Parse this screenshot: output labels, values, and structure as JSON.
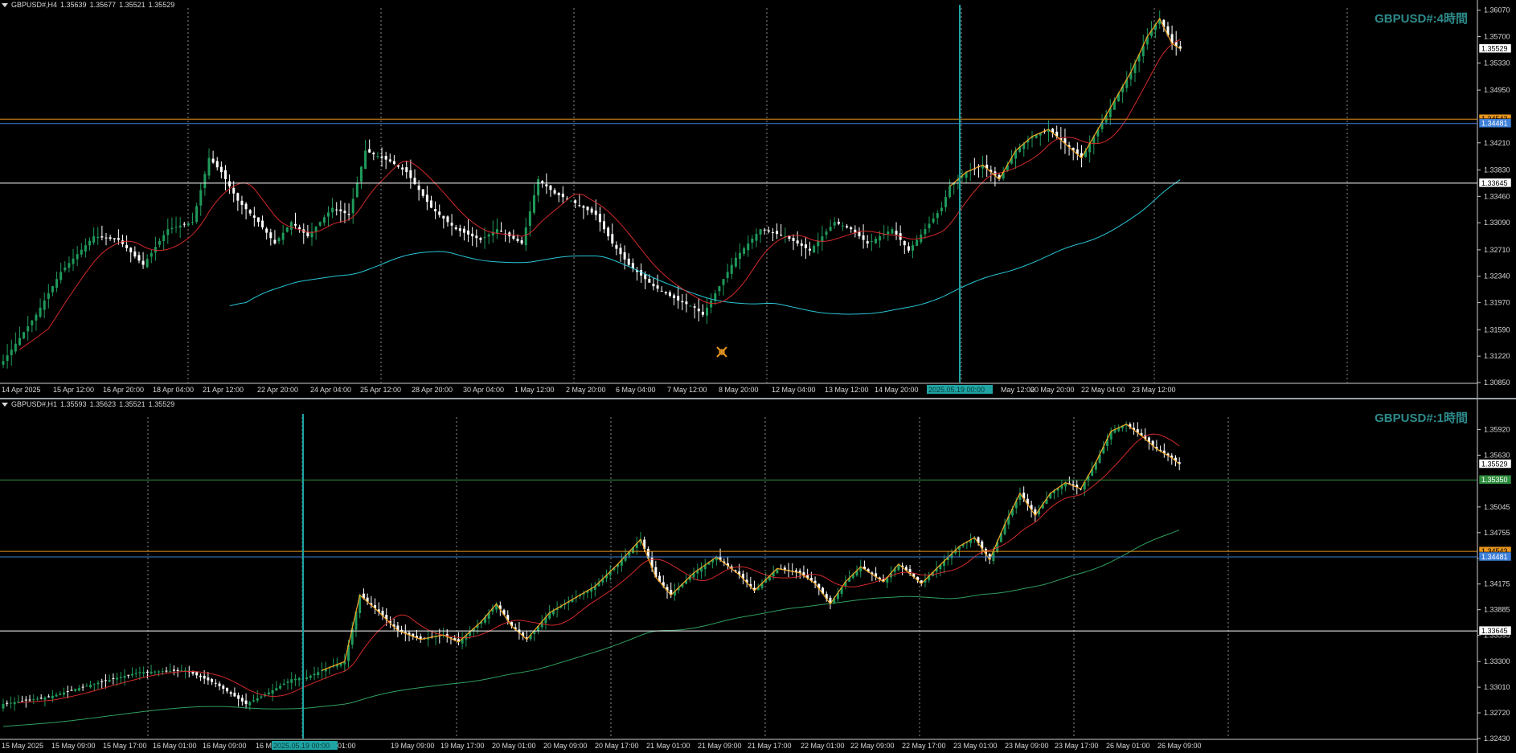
{
  "charts": [
    {
      "symbol": "GBPUSD#,H4",
      "ohlc": [
        "1.35639",
        "1.35677",
        "1.35521",
        "1.35529"
      ],
      "title": "GBPUSD#:4時間",
      "price_axis": [
        "1.36070",
        "1.35700",
        "1.35330",
        "1.34950",
        "1.34210",
        "1.33830",
        "1.33460",
        "1.33090",
        "1.32710",
        "1.32340",
        "1.31970",
        "1.31590",
        "1.31220",
        "1.30850"
      ],
      "time_axis": [
        "14 Apr 2025",
        "15 Apr 12:00",
        "16 Apr 20:00",
        "18 Apr 04:00",
        "21 Apr 12:00",
        "22 Apr 20:00",
        "24 Apr 04:00",
        "25 Apr 12:00",
        "28 Apr 20:00",
        "30 Apr 04:00",
        "1 May 12:00",
        "2 May 20:00",
        "6 May 04:00",
        "7 May 12:00",
        "8 May 20:00",
        "12 May 04:00",
        "13 May 12:00",
        "14 May 20:00",
        "2025.05.19 00:00",
        "May 12:00",
        "20 May 20:00",
        "22 May 04:00",
        "23 May 12:00"
      ],
      "level_tags": [
        "1.35529",
        "1.34543",
        "1.34481",
        "1.33645"
      ],
      "cursor_label": "2025.05.19 00:00"
    },
    {
      "symbol": "GBPUSD#,H1",
      "ohlc": [
        "1.35593",
        "1.35623",
        "1.35521",
        "1.35529"
      ],
      "title": "GBPUSD#:1時間",
      "price_axis": [
        "1.35920",
        "1.35630",
        "1.35045",
        "1.34755",
        "1.34465",
        "1.34175",
        "1.33885",
        "1.33595",
        "1.33300",
        "1.33010",
        "1.32720",
        "1.32430"
      ],
      "time_axis": [
        "15 May 2025",
        "15 May 09:00",
        "15 May 17:00",
        "16 May 01:00",
        "16 May 09:00",
        "16 M",
        "2025.05.19 00:00",
        "01:00",
        "19 May 09:00",
        "19 May 17:00",
        "20 May 01:00",
        "20 May 09:00",
        "20 May 17:00",
        "21 May 01:00",
        "21 May 09:00",
        "21 May 17:00",
        "22 May 01:00",
        "22 May 09:00",
        "22 May 17:00",
        "23 May 01:00",
        "23 May 09:00",
        "23 May 17:00",
        "26 May 01:00",
        "26 May 09:00"
      ],
      "level_tags": [
        "1.35529",
        "1.35350",
        "1.34543",
        "1.34481",
        "1.33645"
      ],
      "cursor_label": "2025.05.19 00:00"
    }
  ],
  "colors": {
    "bull": "#1f9a5a",
    "bear": "#ffffff",
    "ma_fast": "#d42a2a",
    "ma_slow_h4": "#29c6d6",
    "ma_slow_h1": "#2f9f5f",
    "zigzag": "#f5a623",
    "grid": "#c8c8c8",
    "cursor": "#1fa3a3",
    "level_orange": "#e8961e",
    "level_blue": "#3e7fd8",
    "level_white": "#ffffff",
    "level_green": "#2f8f3f",
    "title": "#2e8b8b"
  },
  "chart_data": [
    {
      "type": "candlestick",
      "timeframe": "H4",
      "title": "GBPUSD#:4時間",
      "ylim": [
        1.3085,
        1.361
      ],
      "anchors": [
        [
          0,
          1.3115
        ],
        [
          8,
          1.318
        ],
        [
          14,
          1.324
        ],
        [
          22,
          1.329
        ],
        [
          28,
          1.3285
        ],
        [
          34,
          1.325
        ],
        [
          40,
          1.33
        ],
        [
          46,
          1.331
        ],
        [
          50,
          1.34
        ],
        [
          53,
          1.338
        ],
        [
          57,
          1.334
        ],
        [
          62,
          1.331
        ],
        [
          66,
          1.328
        ],
        [
          70,
          1.331
        ],
        [
          74,
          1.329
        ],
        [
          80,
          1.333
        ],
        [
          84,
          1.332
        ],
        [
          88,
          1.341
        ],
        [
          94,
          1.3395
        ],
        [
          98,
          1.338
        ],
        [
          104,
          1.333
        ],
        [
          110,
          1.33
        ],
        [
          116,
          1.3285
        ],
        [
          120,
          1.33
        ],
        [
          126,
          1.328
        ],
        [
          130,
          1.337
        ],
        [
          134,
          1.335
        ],
        [
          138,
          1.334
        ],
        [
          144,
          1.332
        ],
        [
          148,
          1.328
        ],
        [
          152,
          1.325
        ],
        [
          158,
          1.322
        ],
        [
          164,
          1.32
        ],
        [
          168,
          1.319
        ],
        [
          170,
          1.318
        ],
        [
          174,
          1.322
        ],
        [
          178,
          1.326
        ],
        [
          184,
          1.33
        ],
        [
          190,
          1.329
        ],
        [
          196,
          1.327
        ],
        [
          202,
          1.331
        ],
        [
          206,
          1.33
        ],
        [
          210,
          1.328
        ],
        [
          216,
          1.33
        ],
        [
          220,
          1.327
        ],
        [
          224,
          1.33
        ],
        [
          228,
          1.333
        ],
        [
          230,
          1.336
        ],
        [
          234,
          1.338
        ],
        [
          238,
          1.339
        ],
        [
          242,
          1.337
        ],
        [
          246,
          1.341
        ],
        [
          250,
          1.343
        ],
        [
          254,
          1.344
        ],
        [
          258,
          1.342
        ],
        [
          262,
          1.34
        ],
        [
          266,
          1.344
        ],
        [
          270,
          1.348
        ],
        [
          274,
          1.352
        ],
        [
          278,
          1.357
        ],
        [
          281,
          1.3595
        ],
        [
          284,
          1.356
        ],
        [
          286,
          1.3553
        ]
      ],
      "candle_count": 287,
      "levels": {
        "orange": 1.34543,
        "blue": 1.34481,
        "white": 1.33645,
        "last": 1.35529
      },
      "series": [
        {
          "name": "zigzag"
        },
        {
          "name": "MA fast"
        },
        {
          "name": "MA slow"
        }
      ]
    },
    {
      "type": "candlestick",
      "timeframe": "H1",
      "title": "GBPUSD#:1時間",
      "ylim": [
        1.3243,
        1.3606
      ],
      "anchors": [
        [
          0,
          1.3282
        ],
        [
          12,
          1.329
        ],
        [
          24,
          1.3305
        ],
        [
          36,
          1.3318
        ],
        [
          48,
          1.332
        ],
        [
          56,
          1.3305
        ],
        [
          64,
          1.3282
        ],
        [
          70,
          1.3295
        ],
        [
          76,
          1.331
        ],
        [
          80,
          1.3312
        ],
        [
          84,
          1.332
        ],
        [
          90,
          1.333
        ],
        [
          94,
          1.3405
        ],
        [
          98,
          1.339
        ],
        [
          104,
          1.3365
        ],
        [
          110,
          1.3355
        ],
        [
          116,
          1.336
        ],
        [
          120,
          1.3352
        ],
        [
          126,
          1.3375
        ],
        [
          130,
          1.3395
        ],
        [
          134,
          1.337
        ],
        [
          138,
          1.3355
        ],
        [
          144,
          1.3385
        ],
        [
          150,
          1.34
        ],
        [
          156,
          1.3415
        ],
        [
          162,
          1.344
        ],
        [
          168,
          1.3468
        ],
        [
          172,
          1.3425
        ],
        [
          176,
          1.3405
        ],
        [
          182,
          1.343
        ],
        [
          188,
          1.3448
        ],
        [
          194,
          1.3428
        ],
        [
          198,
          1.341
        ],
        [
          204,
          1.3435
        ],
        [
          210,
          1.343
        ],
        [
          214,
          1.3418
        ],
        [
          218,
          1.3395
        ],
        [
          222,
          1.342
        ],
        [
          226,
          1.3437
        ],
        [
          232,
          1.342
        ],
        [
          236,
          1.344
        ],
        [
          242,
          1.3418
        ],
        [
          246,
          1.3435
        ],
        [
          252,
          1.346
        ],
        [
          256,
          1.347
        ],
        [
          260,
          1.3445
        ],
        [
          264,
          1.3485
        ],
        [
          268,
          1.352
        ],
        [
          272,
          1.3495
        ],
        [
          276,
          1.352
        ],
        [
          280,
          1.3532
        ],
        [
          284,
          1.3525
        ],
        [
          288,
          1.3555
        ],
        [
          292,
          1.359
        ],
        [
          296,
          1.3598
        ],
        [
          300,
          1.3585
        ],
        [
          304,
          1.357
        ],
        [
          308,
          1.356
        ],
        [
          310,
          1.3553
        ]
      ],
      "candle_count": 311,
      "levels": {
        "green": 1.3535,
        "orange": 1.34543,
        "blue": 1.34481,
        "white": 1.33645,
        "last": 1.35529
      },
      "series": [
        {
          "name": "zigzag"
        },
        {
          "name": "MA fast"
        },
        {
          "name": "MA slow"
        }
      ]
    }
  ]
}
